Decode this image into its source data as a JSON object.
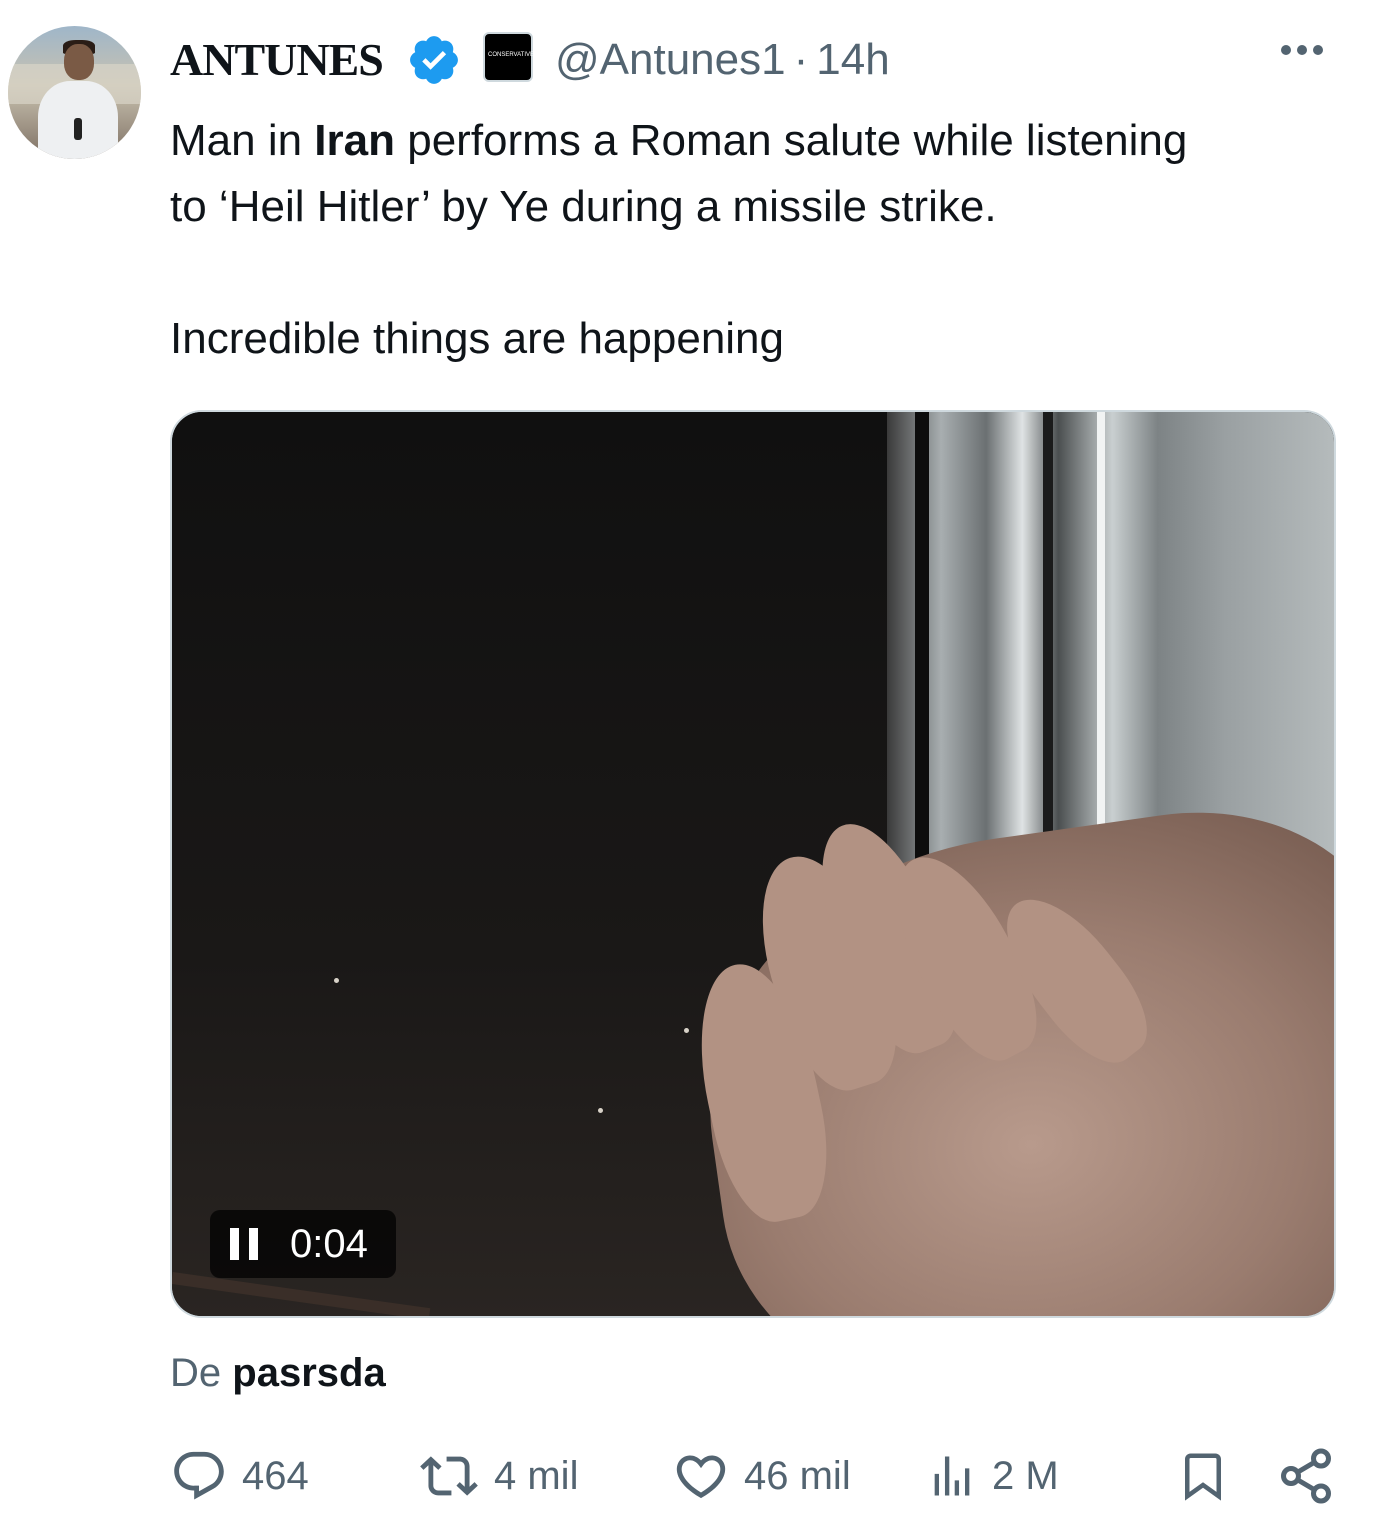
{
  "tweet": {
    "author_name": "ANTUNES",
    "affiliation_badge": "CONSERVATIVE",
    "handle": "@Antunes1",
    "separator": "·",
    "time": "14h",
    "text_line1_pre": "Man in ",
    "text_line1_bold": "Iran",
    "text_line1_post": " performs a Roman salute while listening",
    "text_line2": "to ‘Heil Hitler’ by Ye during a missile strike.",
    "text_line3": "Incredible things are happening"
  },
  "video": {
    "elapsed": "0:04"
  },
  "source": {
    "prefix": "De",
    "name": "pasrsda"
  },
  "actions": {
    "replies": "464",
    "reposts": "4 mil",
    "likes": "46 mil",
    "views": "2 M"
  },
  "icons": {
    "verified": "verified-badge-icon",
    "more": "more-icon",
    "reply": "reply-icon",
    "repost": "repost-icon",
    "like": "heart-icon",
    "views": "views-icon",
    "bookmark": "bookmark-icon",
    "share": "share-icon",
    "pause": "pause-icon"
  },
  "colors": {
    "verified_blue": "#1d9bf0",
    "secondary_text": "#536471",
    "primary_text": "#0f1419"
  }
}
